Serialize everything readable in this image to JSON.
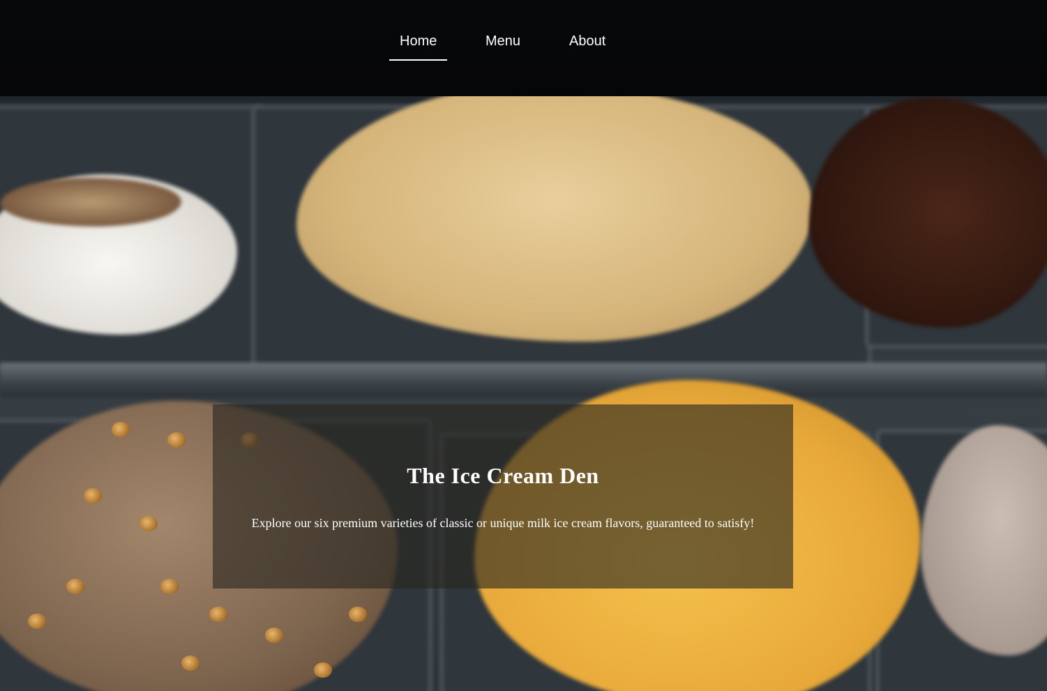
{
  "nav": {
    "items": [
      {
        "label": "Home",
        "active": true
      },
      {
        "label": "Menu",
        "active": false
      },
      {
        "label": "About",
        "active": false
      }
    ]
  },
  "hero": {
    "title": "The Ice Cream Den",
    "subtitle": "Explore our six premium varieties of classic or unique milk ice cream flavors, guaranteed to satisfy!"
  },
  "colors": {
    "nav_background": "#050608",
    "hero_overlay": "rgba(40, 38, 32, 0.62)",
    "text": "#ffffff"
  }
}
